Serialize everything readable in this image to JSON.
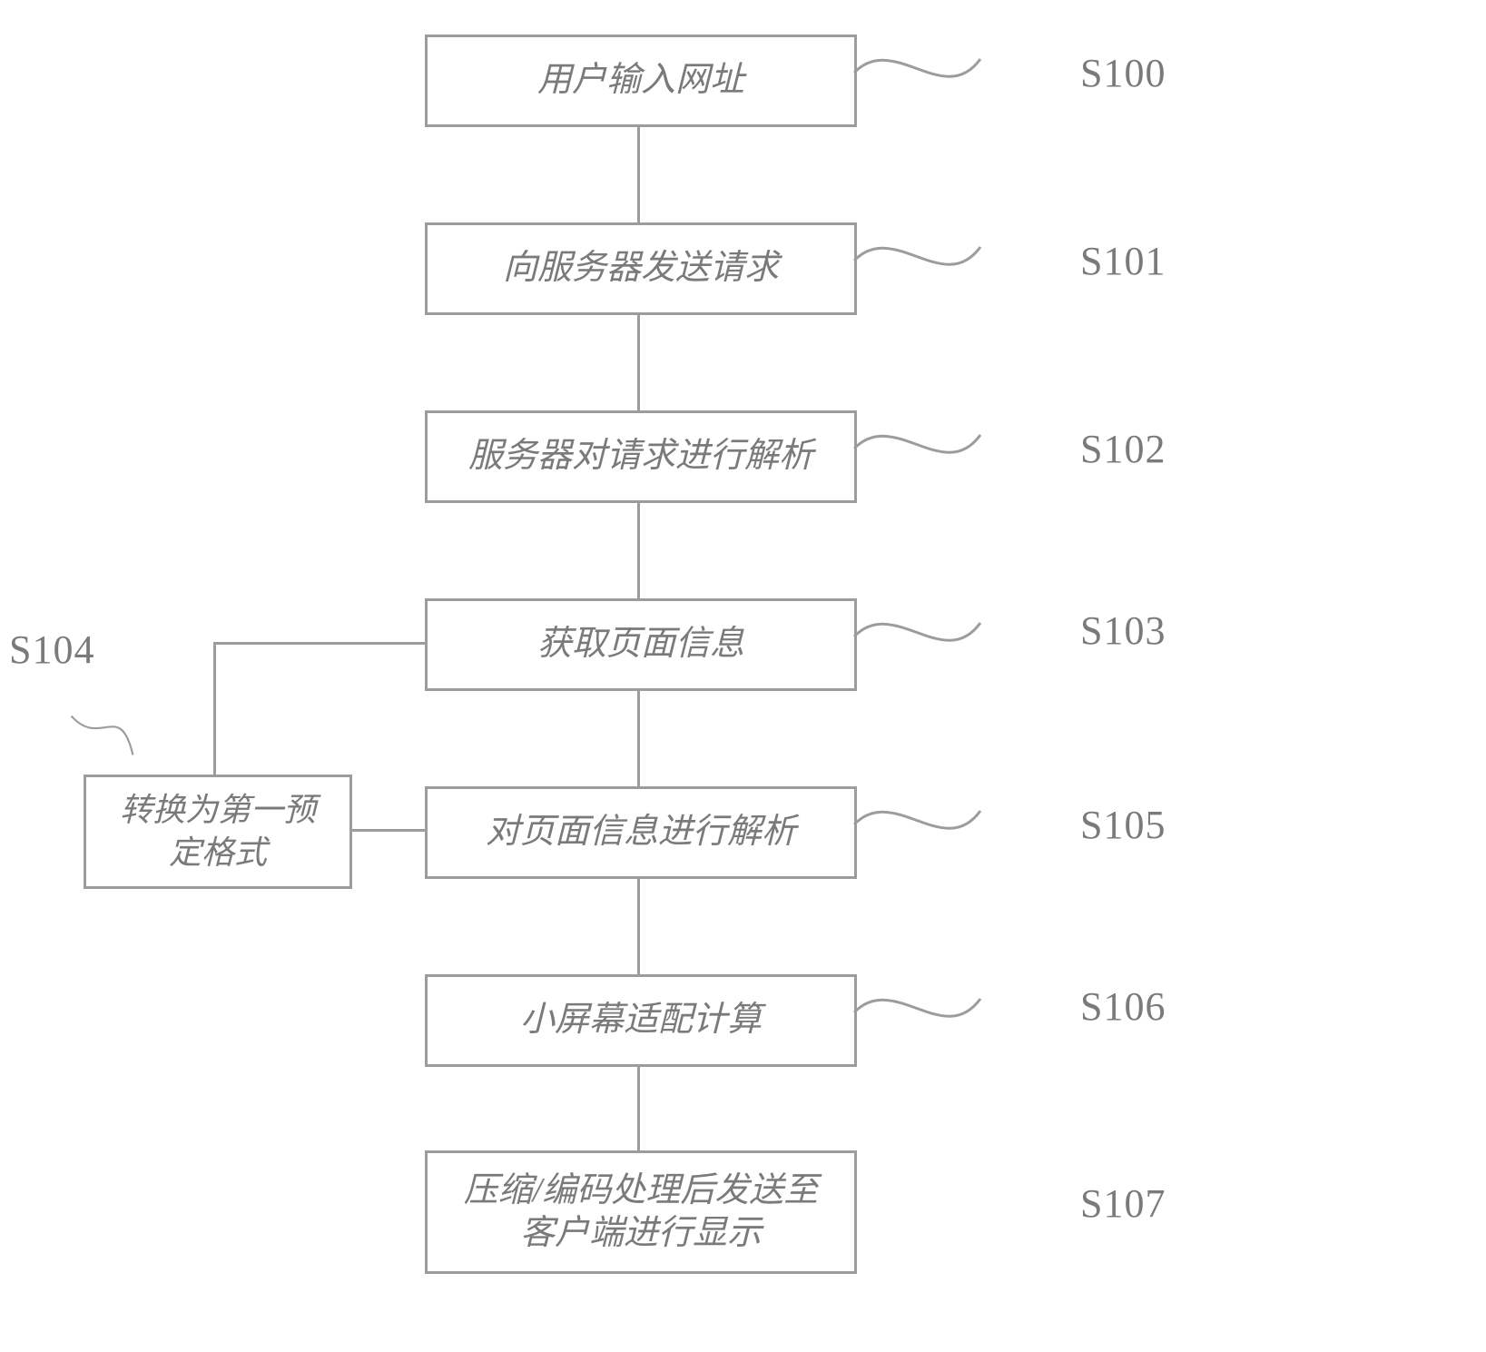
{
  "flow": {
    "steps": {
      "s100": {
        "text": "用户输入网址",
        "code": "S100"
      },
      "s101": {
        "text": "向服务器发送请求",
        "code": "S101"
      },
      "s102": {
        "text": "服务器对请求进行解析",
        "code": "S102"
      },
      "s103": {
        "text": "获取页面信息",
        "code": "S103"
      },
      "s104": {
        "text": "转换为第一预\n定格式",
        "code": "S104"
      },
      "s105": {
        "text": "对页面信息进行解析",
        "code": "S105"
      },
      "s106": {
        "text": "小屏幕适配计算",
        "code": "S106"
      },
      "s107": {
        "text": "压缩/编码处理后发送至\n客户端进行显示",
        "code": "S107"
      }
    }
  }
}
